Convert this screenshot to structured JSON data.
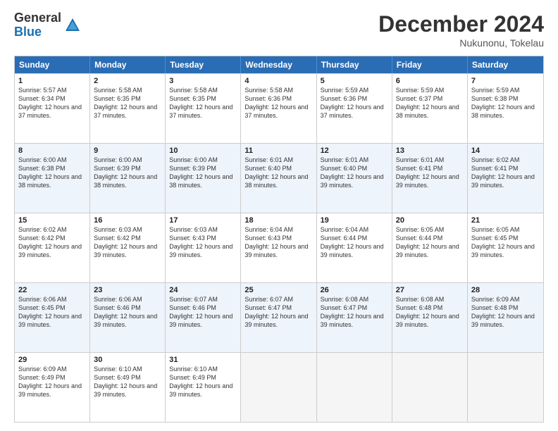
{
  "logo": {
    "general": "General",
    "blue": "Blue"
  },
  "title": "December 2024",
  "location": "Nukunonu, Tokelau",
  "days_of_week": [
    "Sunday",
    "Monday",
    "Tuesday",
    "Wednesday",
    "Thursday",
    "Friday",
    "Saturday"
  ],
  "weeks": [
    [
      {
        "day": "1",
        "sunrise": "5:57 AM",
        "sunset": "6:34 PM",
        "daylight": "12 hours and 37 minutes."
      },
      {
        "day": "2",
        "sunrise": "5:58 AM",
        "sunset": "6:35 PM",
        "daylight": "12 hours and 37 minutes."
      },
      {
        "day": "3",
        "sunrise": "5:58 AM",
        "sunset": "6:35 PM",
        "daylight": "12 hours and 37 minutes."
      },
      {
        "day": "4",
        "sunrise": "5:58 AM",
        "sunset": "6:36 PM",
        "daylight": "12 hours and 37 minutes."
      },
      {
        "day": "5",
        "sunrise": "5:59 AM",
        "sunset": "6:36 PM",
        "daylight": "12 hours and 37 minutes."
      },
      {
        "day": "6",
        "sunrise": "5:59 AM",
        "sunset": "6:37 PM",
        "daylight": "12 hours and 38 minutes."
      },
      {
        "day": "7",
        "sunrise": "5:59 AM",
        "sunset": "6:38 PM",
        "daylight": "12 hours and 38 minutes."
      }
    ],
    [
      {
        "day": "8",
        "sunrise": "6:00 AM",
        "sunset": "6:38 PM",
        "daylight": "12 hours and 38 minutes."
      },
      {
        "day": "9",
        "sunrise": "6:00 AM",
        "sunset": "6:39 PM",
        "daylight": "12 hours and 38 minutes."
      },
      {
        "day": "10",
        "sunrise": "6:00 AM",
        "sunset": "6:39 PM",
        "daylight": "12 hours and 38 minutes."
      },
      {
        "day": "11",
        "sunrise": "6:01 AM",
        "sunset": "6:40 PM",
        "daylight": "12 hours and 38 minutes."
      },
      {
        "day": "12",
        "sunrise": "6:01 AM",
        "sunset": "6:40 PM",
        "daylight": "12 hours and 39 minutes."
      },
      {
        "day": "13",
        "sunrise": "6:01 AM",
        "sunset": "6:41 PM",
        "daylight": "12 hours and 39 minutes."
      },
      {
        "day": "14",
        "sunrise": "6:02 AM",
        "sunset": "6:41 PM",
        "daylight": "12 hours and 39 minutes."
      }
    ],
    [
      {
        "day": "15",
        "sunrise": "6:02 AM",
        "sunset": "6:42 PM",
        "daylight": "12 hours and 39 minutes."
      },
      {
        "day": "16",
        "sunrise": "6:03 AM",
        "sunset": "6:42 PM",
        "daylight": "12 hours and 39 minutes."
      },
      {
        "day": "17",
        "sunrise": "6:03 AM",
        "sunset": "6:43 PM",
        "daylight": "12 hours and 39 minutes."
      },
      {
        "day": "18",
        "sunrise": "6:04 AM",
        "sunset": "6:43 PM",
        "daylight": "12 hours and 39 minutes."
      },
      {
        "day": "19",
        "sunrise": "6:04 AM",
        "sunset": "6:44 PM",
        "daylight": "12 hours and 39 minutes."
      },
      {
        "day": "20",
        "sunrise": "6:05 AM",
        "sunset": "6:44 PM",
        "daylight": "12 hours and 39 minutes."
      },
      {
        "day": "21",
        "sunrise": "6:05 AM",
        "sunset": "6:45 PM",
        "daylight": "12 hours and 39 minutes."
      }
    ],
    [
      {
        "day": "22",
        "sunrise": "6:06 AM",
        "sunset": "6:45 PM",
        "daylight": "12 hours and 39 minutes."
      },
      {
        "day": "23",
        "sunrise": "6:06 AM",
        "sunset": "6:46 PM",
        "daylight": "12 hours and 39 minutes."
      },
      {
        "day": "24",
        "sunrise": "6:07 AM",
        "sunset": "6:46 PM",
        "daylight": "12 hours and 39 minutes."
      },
      {
        "day": "25",
        "sunrise": "6:07 AM",
        "sunset": "6:47 PM",
        "daylight": "12 hours and 39 minutes."
      },
      {
        "day": "26",
        "sunrise": "6:08 AM",
        "sunset": "6:47 PM",
        "daylight": "12 hours and 39 minutes."
      },
      {
        "day": "27",
        "sunrise": "6:08 AM",
        "sunset": "6:48 PM",
        "daylight": "12 hours and 39 minutes."
      },
      {
        "day": "28",
        "sunrise": "6:09 AM",
        "sunset": "6:48 PM",
        "daylight": "12 hours and 39 minutes."
      }
    ],
    [
      {
        "day": "29",
        "sunrise": "6:09 AM",
        "sunset": "6:49 PM",
        "daylight": "12 hours and 39 minutes."
      },
      {
        "day": "30",
        "sunrise": "6:10 AM",
        "sunset": "6:49 PM",
        "daylight": "12 hours and 39 minutes."
      },
      {
        "day": "31",
        "sunrise": "6:10 AM",
        "sunset": "6:49 PM",
        "daylight": "12 hours and 39 minutes."
      },
      null,
      null,
      null,
      null
    ]
  ]
}
